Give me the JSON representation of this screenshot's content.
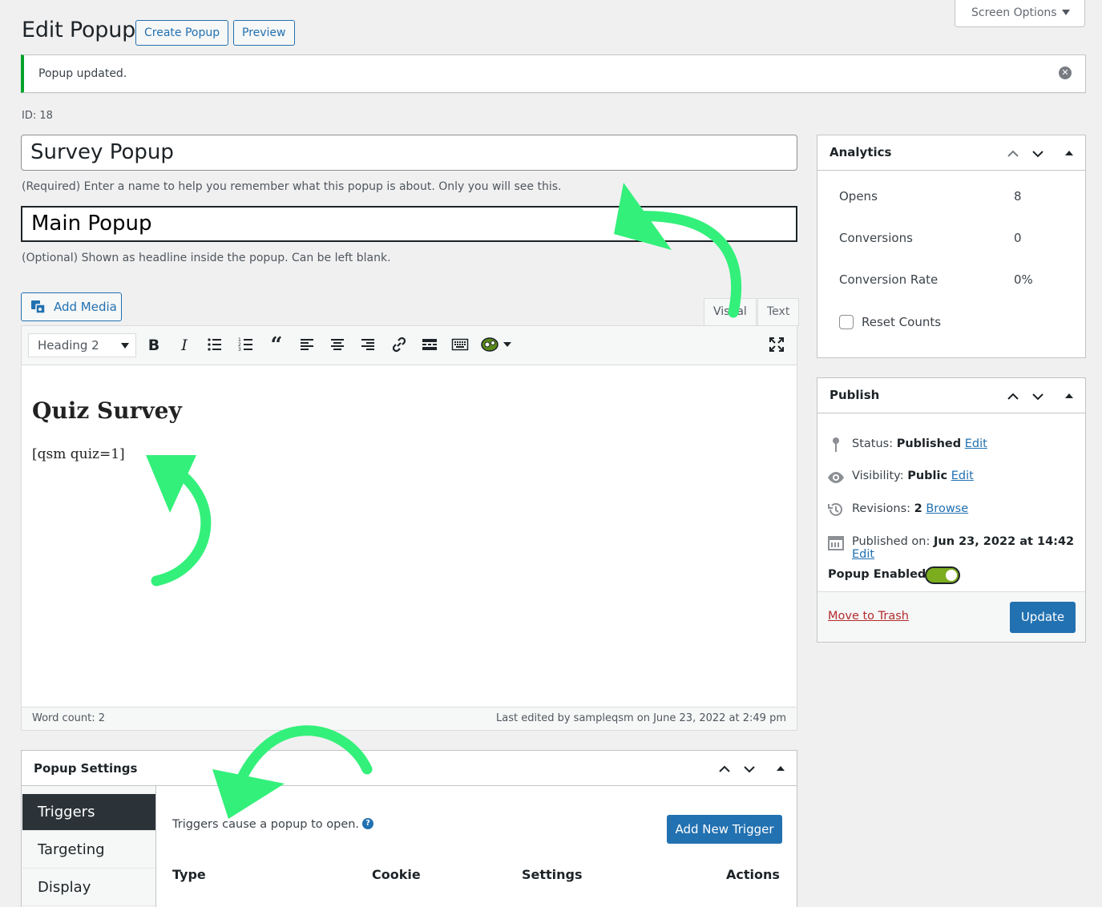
{
  "header": {
    "title": "Edit Popup",
    "create_button": "Create Popup",
    "preview_button": "Preview",
    "screen_options": "Screen Options"
  },
  "notice": {
    "text": "Popup updated."
  },
  "post_id": "ID: 18",
  "title_field": {
    "value": "Survey Popup",
    "hint": "(Required) Enter a name to help you remember what this popup is about. Only you will see this."
  },
  "headline_field": {
    "value": "Main Popup",
    "hint": "(Optional) Shown as headline inside the popup. Can be left blank."
  },
  "editor": {
    "add_media": "Add Media",
    "tab_visual": "Visual",
    "tab_text": "Text",
    "format_select": "Heading 2",
    "heading": "Quiz Survey",
    "paragraph": "[qsm quiz=1]",
    "word_count": "Word count: 2",
    "last_edited": "Last edited by sampleqsm on June 23, 2022 at 2:49 pm"
  },
  "analytics": {
    "title": "Analytics",
    "rows": [
      {
        "label": "Opens",
        "value": "8"
      },
      {
        "label": "Conversions",
        "value": "0"
      },
      {
        "label": "Conversion Rate",
        "value": "0%"
      }
    ],
    "reset_label": "Reset Counts"
  },
  "publish": {
    "title": "Publish",
    "status_label": "Status:",
    "status_value": "Published",
    "visibility_label": "Visibility:",
    "visibility_value": "Public",
    "revisions_label": "Revisions:",
    "revisions_value": "2",
    "browse": "Browse",
    "published_label": "Published on:",
    "published_value": "Jun 23, 2022 at 14:42",
    "edit": "Edit",
    "popup_enabled": "Popup Enabled",
    "popup_enabled_state": true,
    "trash": "Move to Trash",
    "update": "Update"
  },
  "popup_settings": {
    "title": "Popup Settings",
    "tabs": [
      "Triggers",
      "Targeting",
      "Display"
    ],
    "active_tab": "Triggers",
    "description": "Triggers cause a popup to open.",
    "add_trigger": "Add New Trigger",
    "columns": [
      "Type",
      "Cookie",
      "Settings",
      "Actions"
    ]
  },
  "colors": {
    "accent": "#2271b1",
    "notice_success": "#00a32a",
    "annotation_arrow": "#33f07a",
    "toggle_on": "#7bad1f"
  }
}
